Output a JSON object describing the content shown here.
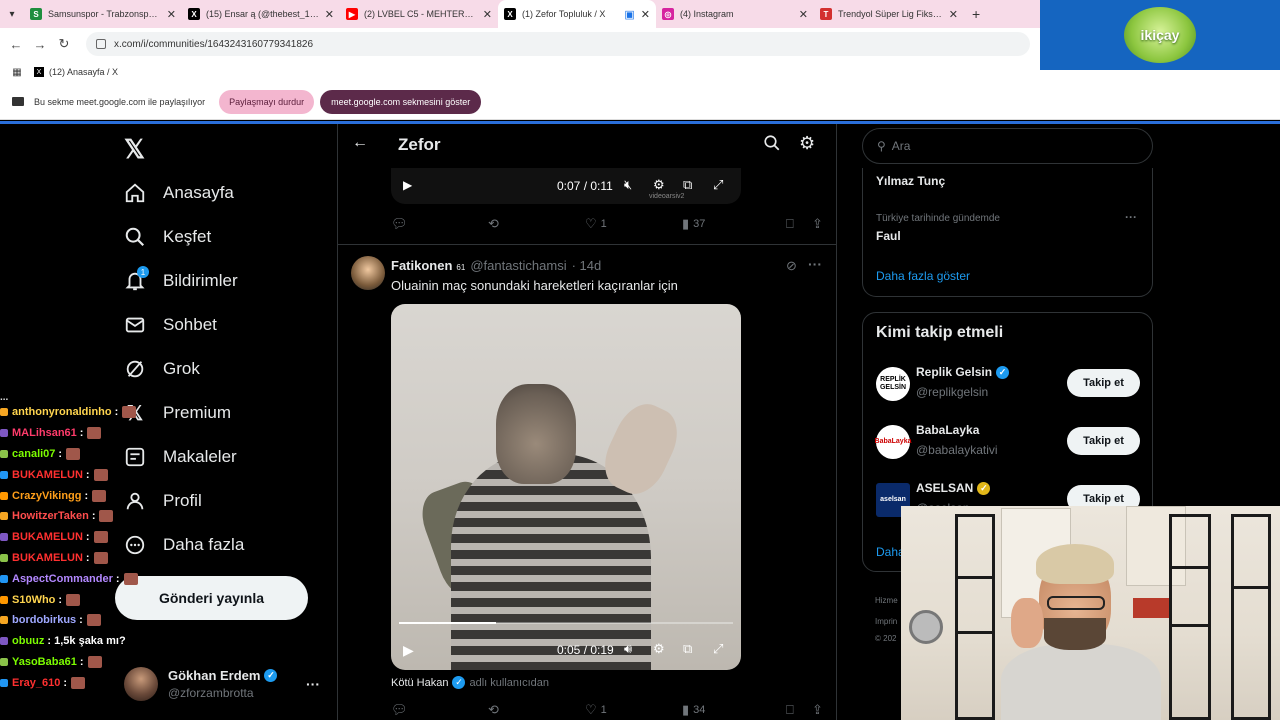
{
  "browser": {
    "tabs": [
      {
        "title": "Samsunspor - Trabzonspor canlı",
        "color": "#1e8e3e",
        "active": false
      },
      {
        "title": "(15) Ensar ą (@thebest_1967) / X",
        "color": "#000000",
        "active": false
      },
      {
        "title": "(2) LVBEL C5 - MEHTERAN REM",
        "color": "#ff0000",
        "active": false
      },
      {
        "title": "(1) Zefor Topluluk / X",
        "color": "#000000",
        "active": true
      },
      {
        "title": "(4) Instagram",
        "color": "#d6249f",
        "active": false
      },
      {
        "title": "Trendyol Süper Lig Fikstürü ve P",
        "color": "#d32f2f",
        "active": false
      }
    ],
    "url": "x.com/i/communities/1643243160779341826",
    "bookmark": "(12) Anasayfa / X",
    "share_text": "Bu sekme meet.google.com ile paylaşılıyor",
    "stop_sharing": "Paylaşmayı durdur",
    "show_tab": "meet.google.com sekmesini göster"
  },
  "overlay_logo": "ikiçay",
  "nav": {
    "items": [
      {
        "label": "Anasayfa",
        "icon": "home-icon"
      },
      {
        "label": "Keşfet",
        "icon": "search-icon"
      },
      {
        "label": "Bildirimler",
        "icon": "bell-icon",
        "badge": "1"
      },
      {
        "label": "Sohbet",
        "icon": "mail-icon"
      },
      {
        "label": "Grok",
        "icon": "grok-icon"
      },
      {
        "label": "Premium",
        "icon": "x-icon"
      },
      {
        "label": "Makaleler",
        "icon": "article-icon"
      },
      {
        "label": "Profil",
        "icon": "person-icon"
      },
      {
        "label": "Daha fazla",
        "icon": "more-circle-icon"
      }
    ],
    "post_button": "Gönderi yayınla",
    "profile": {
      "name": "Gökhan Erdem",
      "handle": "@zforzambrotta"
    }
  },
  "chat": {
    "top_partial": "...",
    "lines": [
      {
        "user": "anthonyronaldinho",
        "msg": ":",
        "color": "#ffd54f"
      },
      {
        "user": "MALihsan61",
        "msg": ":",
        "color": "#ff3b6b"
      },
      {
        "user": "canali07",
        "msg": ":",
        "color": "#7cfc00"
      },
      {
        "user": "BUKAMELUN",
        "msg": ":",
        "color": "#ff3030"
      },
      {
        "user": "CrazyVikingg",
        "msg": ":",
        "color": "#ff9f1a"
      },
      {
        "user": "HowitzerTaken",
        "msg": ":",
        "color": "#ff4d4d"
      },
      {
        "user": "BUKAMELUN",
        "msg": ":",
        "color": "#ff3030"
      },
      {
        "user": "BUKAMELUN",
        "msg": ":",
        "color": "#ff3030"
      },
      {
        "user": "AspectCommander",
        "msg": ":",
        "color": "#b388ff"
      },
      {
        "user": "S10Who",
        "msg": ":",
        "color": "#ffd54f"
      },
      {
        "user": "bordobirkus",
        "msg": ":",
        "color": "#9fa8ff"
      },
      {
        "user": "obuuz",
        "msg": ": 1,5k şaka mı?",
        "color": "#7cfc00"
      },
      {
        "user": "YasoBaba61",
        "msg": ":",
        "color": "#7cfc00"
      },
      {
        "user": "Eray_610",
        "msg": ":",
        "color": "#ff3030"
      }
    ]
  },
  "center": {
    "title": "Zefor",
    "top_video": {
      "time": "0:07 / 0:11",
      "watermark": "videoarsiv2"
    },
    "top_actions": {
      "likes": "1",
      "views": "37"
    },
    "post": {
      "name": "Fatikonen",
      "sub": "61",
      "handle": "@fantastichamsi",
      "age": "· 14d",
      "text": "Oluainin maç sonundaki hareketleri kaçıranlar için",
      "video_time": "0:05 / 0:19",
      "video_progress": 0.29,
      "credit_name": "Kötü Hakan",
      "credit_suffix": "adlı kullanıcıdan",
      "likes": "1",
      "views": "34"
    }
  },
  "right": {
    "search_placeholder": "Ara",
    "trend1": "Yılmaz Tunç",
    "trend_category": "Türkiye tarihinde gündemde",
    "trend2": "Faul",
    "show_more": "Daha fazla göster",
    "follow_title": "Kimi takip etmeli",
    "follow": [
      {
        "name": "Replik Gelsin",
        "handle": "@replikgelsin",
        "badge": "blue",
        "avatar_text": "REPLİK GELSİN"
      },
      {
        "name": "BabaLayka",
        "handle": "@babalaykativi",
        "badge": "",
        "avatar_text": "BabaLayka"
      },
      {
        "name": "ASELSAN",
        "handle": "@aselsan",
        "badge": "gold",
        "avatar_text": "aselsan"
      }
    ],
    "follow_button": "Takip et",
    "follow_more": "Daha",
    "footer1": "Hizme",
    "footer2": "Imprin",
    "footer3": "© 202"
  }
}
